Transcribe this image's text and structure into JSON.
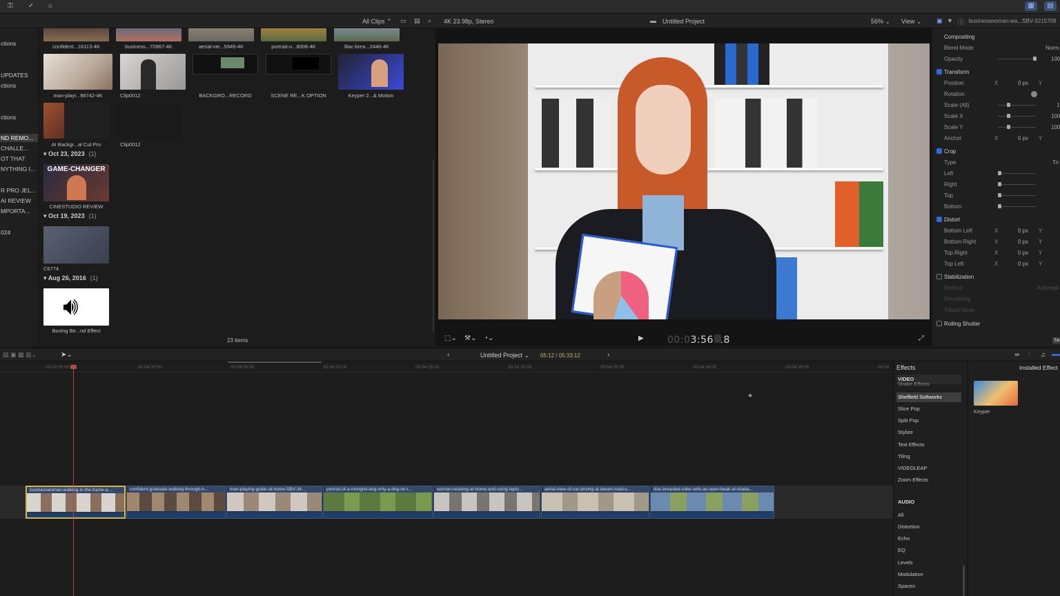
{
  "sidebar": {
    "items": [
      {
        "label": "ctions",
        "selected": false
      },
      {
        "label": "UPDATES",
        "selected": false
      },
      {
        "label": "ctions",
        "selected": false
      },
      {
        "label": "ctions",
        "selected": false
      },
      {
        "label": "ND REMO...",
        "selected": true
      },
      {
        "label": "CHALLE...",
        "selected": false
      },
      {
        "label": "OT THAT",
        "selected": false
      },
      {
        "label": "NYTHING I...",
        "selected": false
      },
      {
        "label": "R PRO JEL...",
        "selected": false
      },
      {
        "label": "AI REVIEW",
        "selected": false
      },
      {
        "label": "MPORTA...",
        "selected": false
      },
      {
        "label": "024",
        "selected": false
      }
    ]
  },
  "browser": {
    "header": {
      "filter": "All Clips",
      "format": "4K 23.98p, Stereo"
    },
    "clips_row1": [
      "confident...16113-4K",
      "business...70967-4K",
      "aerial-vie...5949-4K",
      "portrait-o...8006-4K",
      "lilac-brea...2446-4K"
    ],
    "clips_row2": [
      "man-playi...98742-4K",
      "Clip0012",
      "BACKGRO...RECORD",
      "SCENE RE...K OPTION",
      "Keyper 2...& Motion"
    ],
    "clips_row3": [
      "AI Backgr...al Cut Pro",
      "Clip0012"
    ],
    "dates": [
      {
        "label": "Oct 23, 2023",
        "count": "(1)"
      },
      {
        "label": "Oct 19, 2023",
        "count": "(1)"
      },
      {
        "label": "Aug 26, 2016",
        "count": "(1)"
      }
    ],
    "game_changer": {
      "badge": "GAME-CHANGER",
      "label": "CINESTUDIO REVIEW"
    },
    "c6774": "C6774",
    "boxing": "Boxing Be...nd Effect",
    "items_count": "23 items"
  },
  "viewer": {
    "project_title": "Untitled Project",
    "zoom": "56%",
    "view_menu": "View",
    "timecode_dim": "00:0",
    "timecode": "3:56:18"
  },
  "inspector": {
    "clip_name": "businesswoman-wa...SBV-3215709",
    "compositing": "Compositing",
    "blend_mode_label": "Blend Mode",
    "blend_mode_value": "Norm",
    "opacity_label": "Opacity",
    "opacity_value": "100",
    "transform": "Transform",
    "position": "Position",
    "rotation": "Rotation",
    "scale_all": "Scale (All)",
    "scale_x": "Scale X",
    "scale_y": "Scale Y",
    "anchor": "Anchor",
    "crop": "Crop",
    "type": "Type",
    "type_value": "Tri",
    "left": "Left",
    "right": "Right",
    "top": "Top",
    "bottom": "Bottom",
    "distort": "Distort",
    "bottom_left": "Bottom Left",
    "bottom_right": "Bottom Right",
    "top_right": "Top Right",
    "top_left": "Top Left",
    "stabilization": "Stabilization",
    "method": "Method",
    "method_value": "Automati",
    "smoothing": "Smoothing",
    "tripod_mode": "Tripod Mode",
    "rolling_shutter": "Rolling Shutter",
    "x": "X",
    "y": "Y",
    "zero_px": "0 px",
    "scale_value_1": "1",
    "scale_value_2": "100",
    "scale_value_3": "100",
    "save_btn": "Sa"
  },
  "timeline": {
    "project_title": "Untitled Project",
    "duration": "05:12 / 05:33:12",
    "ruler": [
      "00:03:55:00",
      "00:04:00:00",
      "00:04:05:00",
      "00:04:10:00",
      "00:04:15:00",
      "00:04:20:00",
      "00:04:25:00",
      "00:04:30:00",
      "00:04:35:00",
      "00:04"
    ],
    "clips": [
      "businesswoman-walking-in-the-frame-a...",
      "confident-graduate-walking-through-h...",
      "man-playing-guitar-at-home-SBV-34...",
      "portrait-of-a-mongrel-dog-only-a-dog-on-t...",
      "woman-relaxing-at-home-and-using-lapto...",
      "aerial-view-of-car-driving-at-desert-road-u...",
      "lilac-breasted-roller-with-an-open-beak-at-shaba..."
    ]
  },
  "effects": {
    "title": "Effects",
    "installed": "Installed Effect",
    "video_section": "VIDEO",
    "partial_item": "Shake Effects",
    "items": [
      "Sheffield Softworks",
      "Slice Pop",
      "Split Pop",
      "Stylize",
      "Text Effects",
      "Tiling",
      "VIDEOLEAP",
      "Zoom Effects"
    ],
    "audio_section": "AUDIO",
    "audio_items": [
      "All",
      "Distortion",
      "Echo",
      "EQ",
      "Levels",
      "Modulation",
      "Spaces"
    ],
    "preset_label": "Keyper"
  },
  "colors": {
    "accent": "#2f6ad9",
    "playhead": "#b34a3c",
    "clip": "#3e5a7e",
    "duration": "#c9b56a"
  }
}
